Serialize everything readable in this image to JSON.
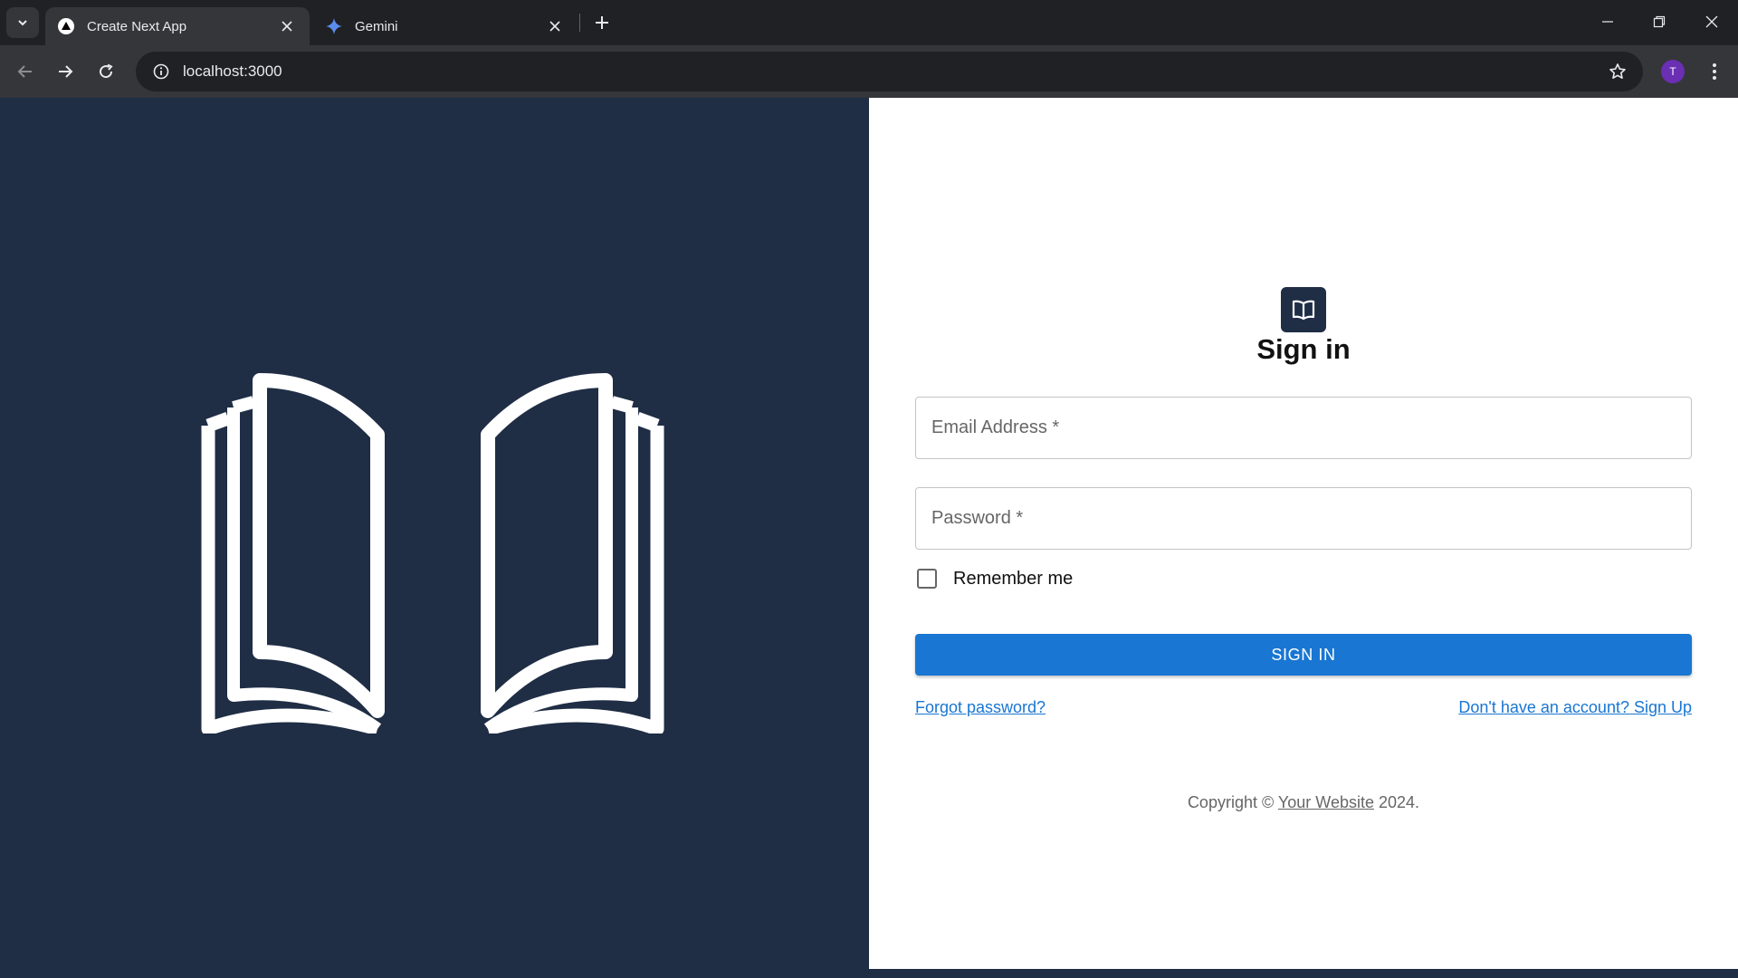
{
  "browser": {
    "tabs": [
      {
        "title": "Create Next App",
        "favicon": "nextjs-triangle-icon",
        "active": true
      },
      {
        "title": "Gemini",
        "favicon": "gemini-sparkle-icon",
        "active": false
      }
    ],
    "url": "localhost:3000",
    "profile_initial": "T",
    "profile_color": "#6a2fb3"
  },
  "hero": {
    "background": "#1f2d45",
    "illustration": "open-book-icon"
  },
  "form": {
    "logo_icon": "menu-book-icon",
    "heading": "Sign in",
    "email_placeholder": "Email Address *",
    "password_placeholder": "Password *",
    "remember_label": "Remember me",
    "submit_label": "SIGN IN",
    "forgot_link": "Forgot password?",
    "signup_link": "Don't have an account? Sign Up",
    "primary_color": "#1976d2"
  },
  "footer": {
    "prefix": "Copyright © ",
    "link": "Your Website",
    "suffix": " 2024."
  }
}
